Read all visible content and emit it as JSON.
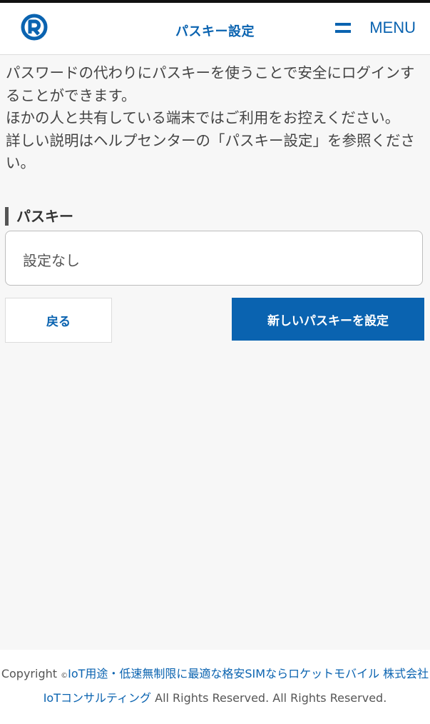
{
  "header": {
    "title": "パスキー設定",
    "menu_label": "MENU",
    "logo_icon": "rocket-mobile-logo-icon",
    "menu_icon": "hamburger-menu-icon"
  },
  "description": {
    "line1": "パスワードの代わりにパスキーを使うことで安全にログインすることができます。",
    "line2": "ほかの人と共有している端末ではご利用をお控えください。",
    "line3": "詳しい説明はヘルプセンターの「パスキー設定」を参照ください。"
  },
  "passkey": {
    "label": "パスキー",
    "value": "設定なし"
  },
  "actions": {
    "back_label": "戻る",
    "set_label": "新しいパスキーを設定"
  },
  "footer": {
    "copyright_word": "Copyright",
    "copyright_mark": "©",
    "link_text": "IoT用途・低速無制限に最適な格安SIMならロケットモバイル 株式会社IoTコンサルティング",
    "rights": "All Rights Reserved. All Rights Reserved."
  },
  "colors": {
    "accent": "#0a63b0",
    "background": "#f7f7f7",
    "surface": "#ffffff"
  }
}
